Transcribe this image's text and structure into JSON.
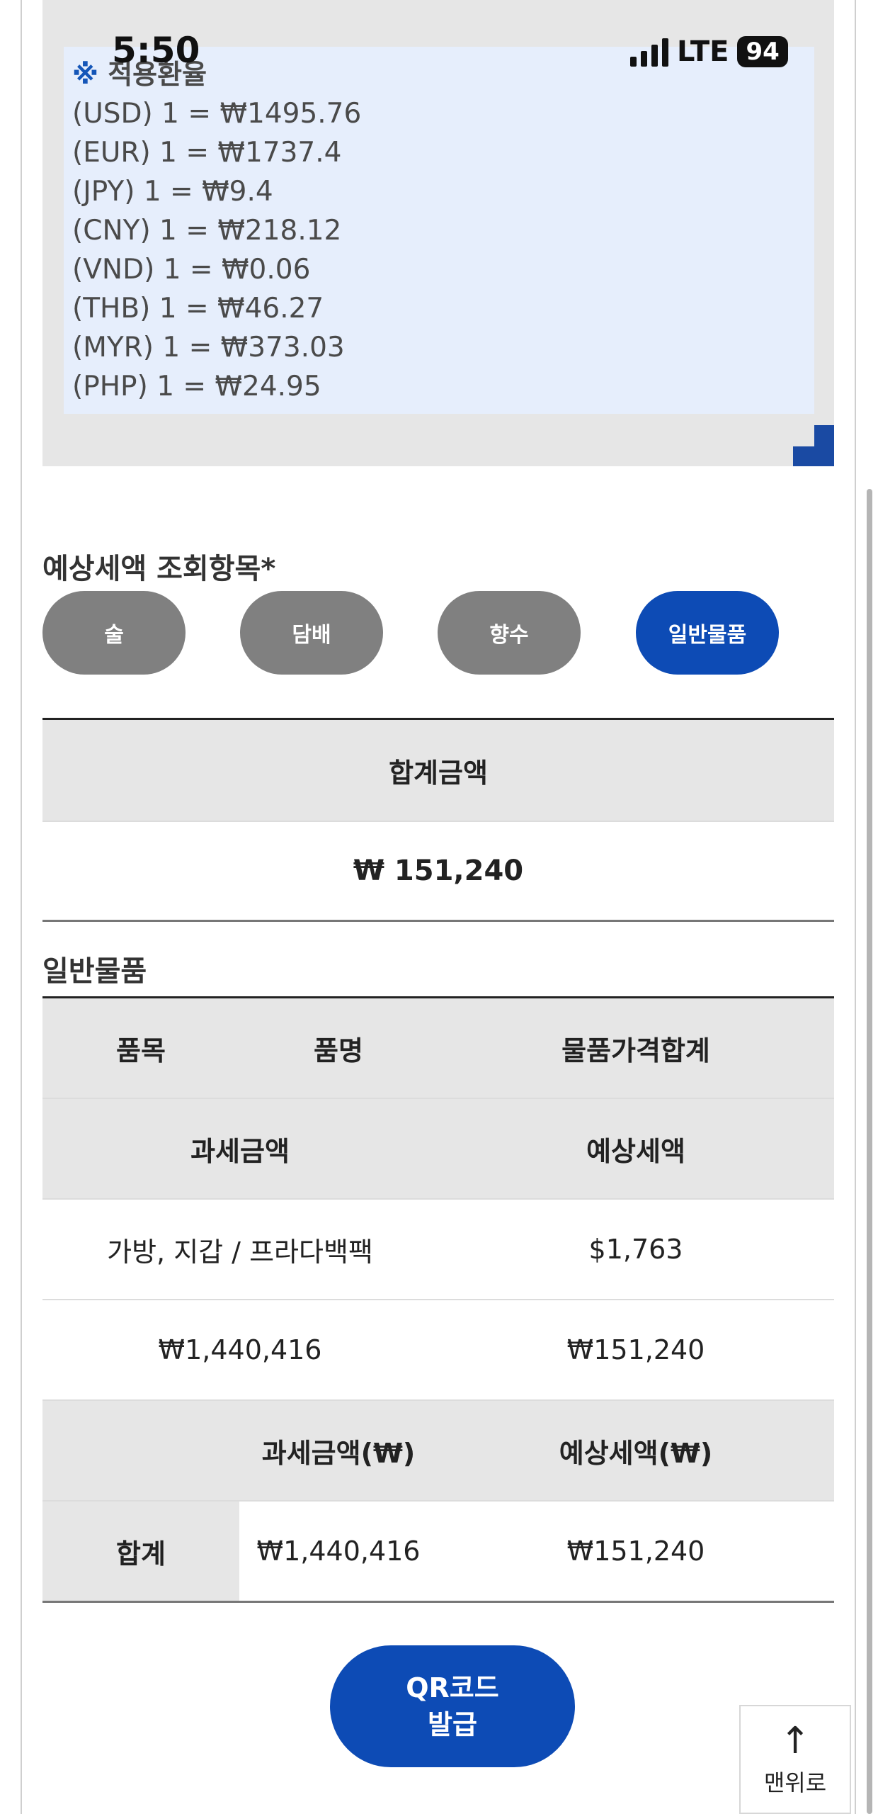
{
  "status_bar": {
    "time": "5:50",
    "network": "LTE",
    "battery": "94"
  },
  "exchange_rates": {
    "title_mark": "※",
    "title": "적용환율",
    "rates": [
      "(USD) 1 = ₩1495.76",
      "(EUR) 1 = ₩1737.4",
      "(JPY) 1 = ₩9.4",
      "(CNY) 1 = ₩218.12",
      "(VND) 1 = ₩0.06",
      "(THB) 1 = ₩46.27",
      "(MYR) 1 = ₩373.03",
      "(PHP) 1 = ₩24.95"
    ]
  },
  "query": {
    "heading": "예상세액 조회항목*",
    "categories": [
      {
        "label": "술",
        "active": false
      },
      {
        "label": "담배",
        "active": false
      },
      {
        "label": "향수",
        "active": false
      },
      {
        "label": "일반물품",
        "active": true
      }
    ]
  },
  "summary": {
    "header": "합계금액",
    "value": "₩ 151,240"
  },
  "general_goods": {
    "section_title": "일반물품",
    "headers": {
      "item": "품목",
      "name": "품명",
      "price_total": "물품가격합계",
      "taxable": "과세금액",
      "est_tax": "예상세액"
    },
    "rows": [
      {
        "item_name": "가방, 지갑 / 프라다백팩",
        "price_total": "$1,763",
        "taxable": "₩1,440,416",
        "est_tax": "₩151,240"
      }
    ],
    "totals": {
      "taxable_header": "과세금액(₩)",
      "tax_header": "예상세액(₩)",
      "label": "합계",
      "taxable": "₩1,440,416",
      "tax": "₩151,240"
    }
  },
  "actions": {
    "qr_line1": "QR코드",
    "qr_line2": "발급",
    "top_label": "맨위로",
    "top_arrow": "↑"
  },
  "colors": {
    "primary": "#0d4bb5",
    "inactive": "#808080",
    "rate_box": "#e6eefc",
    "panel_gray": "#e6e6e6"
  }
}
